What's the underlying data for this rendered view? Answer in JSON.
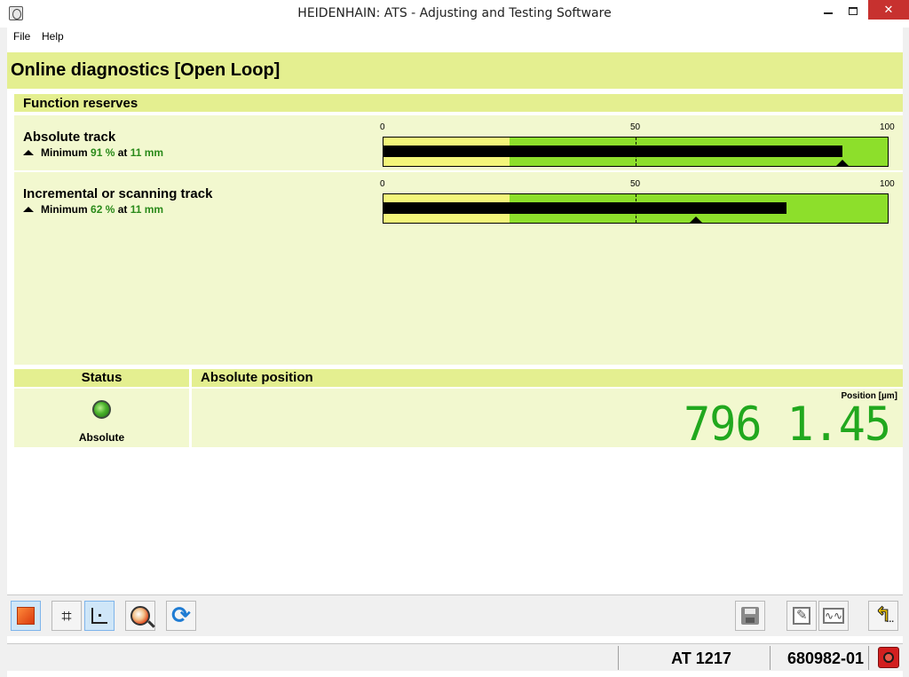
{
  "window": {
    "title": "HEIDENHAIN: ATS - Adjusting and Testing Software",
    "minimize_glyph": "",
    "close_glyph": "✕"
  },
  "menu": {
    "items": [
      {
        "label": "File"
      },
      {
        "label": "Help"
      }
    ]
  },
  "page": {
    "title": "Online diagnostics [Open Loop]"
  },
  "function_reserves": {
    "title": "Function reserves",
    "scale": {
      "min": "0",
      "mid": "50",
      "max": "100"
    },
    "tracks": [
      {
        "name": "Absolute track",
        "min_prefix": "Minimum",
        "min_percent": "91 %",
        "at_label": "at",
        "min_position": "11 mm",
        "current_value": 91,
        "minimum_value": 91,
        "threshold_value": 25
      },
      {
        "name": "Incremental or scanning track",
        "min_prefix": "Minimum",
        "min_percent": "62 %",
        "at_label": "at",
        "min_position": "11 mm",
        "current_value": 80,
        "minimum_value": 62,
        "threshold_value": 25
      }
    ]
  },
  "status": {
    "header": "Status",
    "led_state": "green",
    "label": "Absolute"
  },
  "absolute_position": {
    "header": "Absolute position",
    "unit_label": "Position [µm]",
    "value": "796 1.45"
  },
  "toolbar": {
    "left_buttons": [
      {
        "icon": "stop-icon"
      },
      {
        "icon": "grid-icon"
      },
      {
        "icon": "axes-icon"
      },
      {
        "icon": "magnifier-icon"
      },
      {
        "icon": "refresh-icon"
      }
    ],
    "right_buttons": [
      {
        "icon": "save-icon"
      },
      {
        "icon": "edit-report-icon"
      },
      {
        "icon": "signal-icon"
      },
      {
        "icon": "back-icon",
        "suffix": "..."
      }
    ]
  },
  "statusbar": {
    "device": "AT 1217",
    "id_number": "680982-01"
  },
  "colors": {
    "header_bg": "#e4ef90",
    "panel_bg": "#f2f8cf",
    "bar_green": "#8ddf2b",
    "bar_yellow": "#f3f57a",
    "position_green": "#21a81e"
  }
}
